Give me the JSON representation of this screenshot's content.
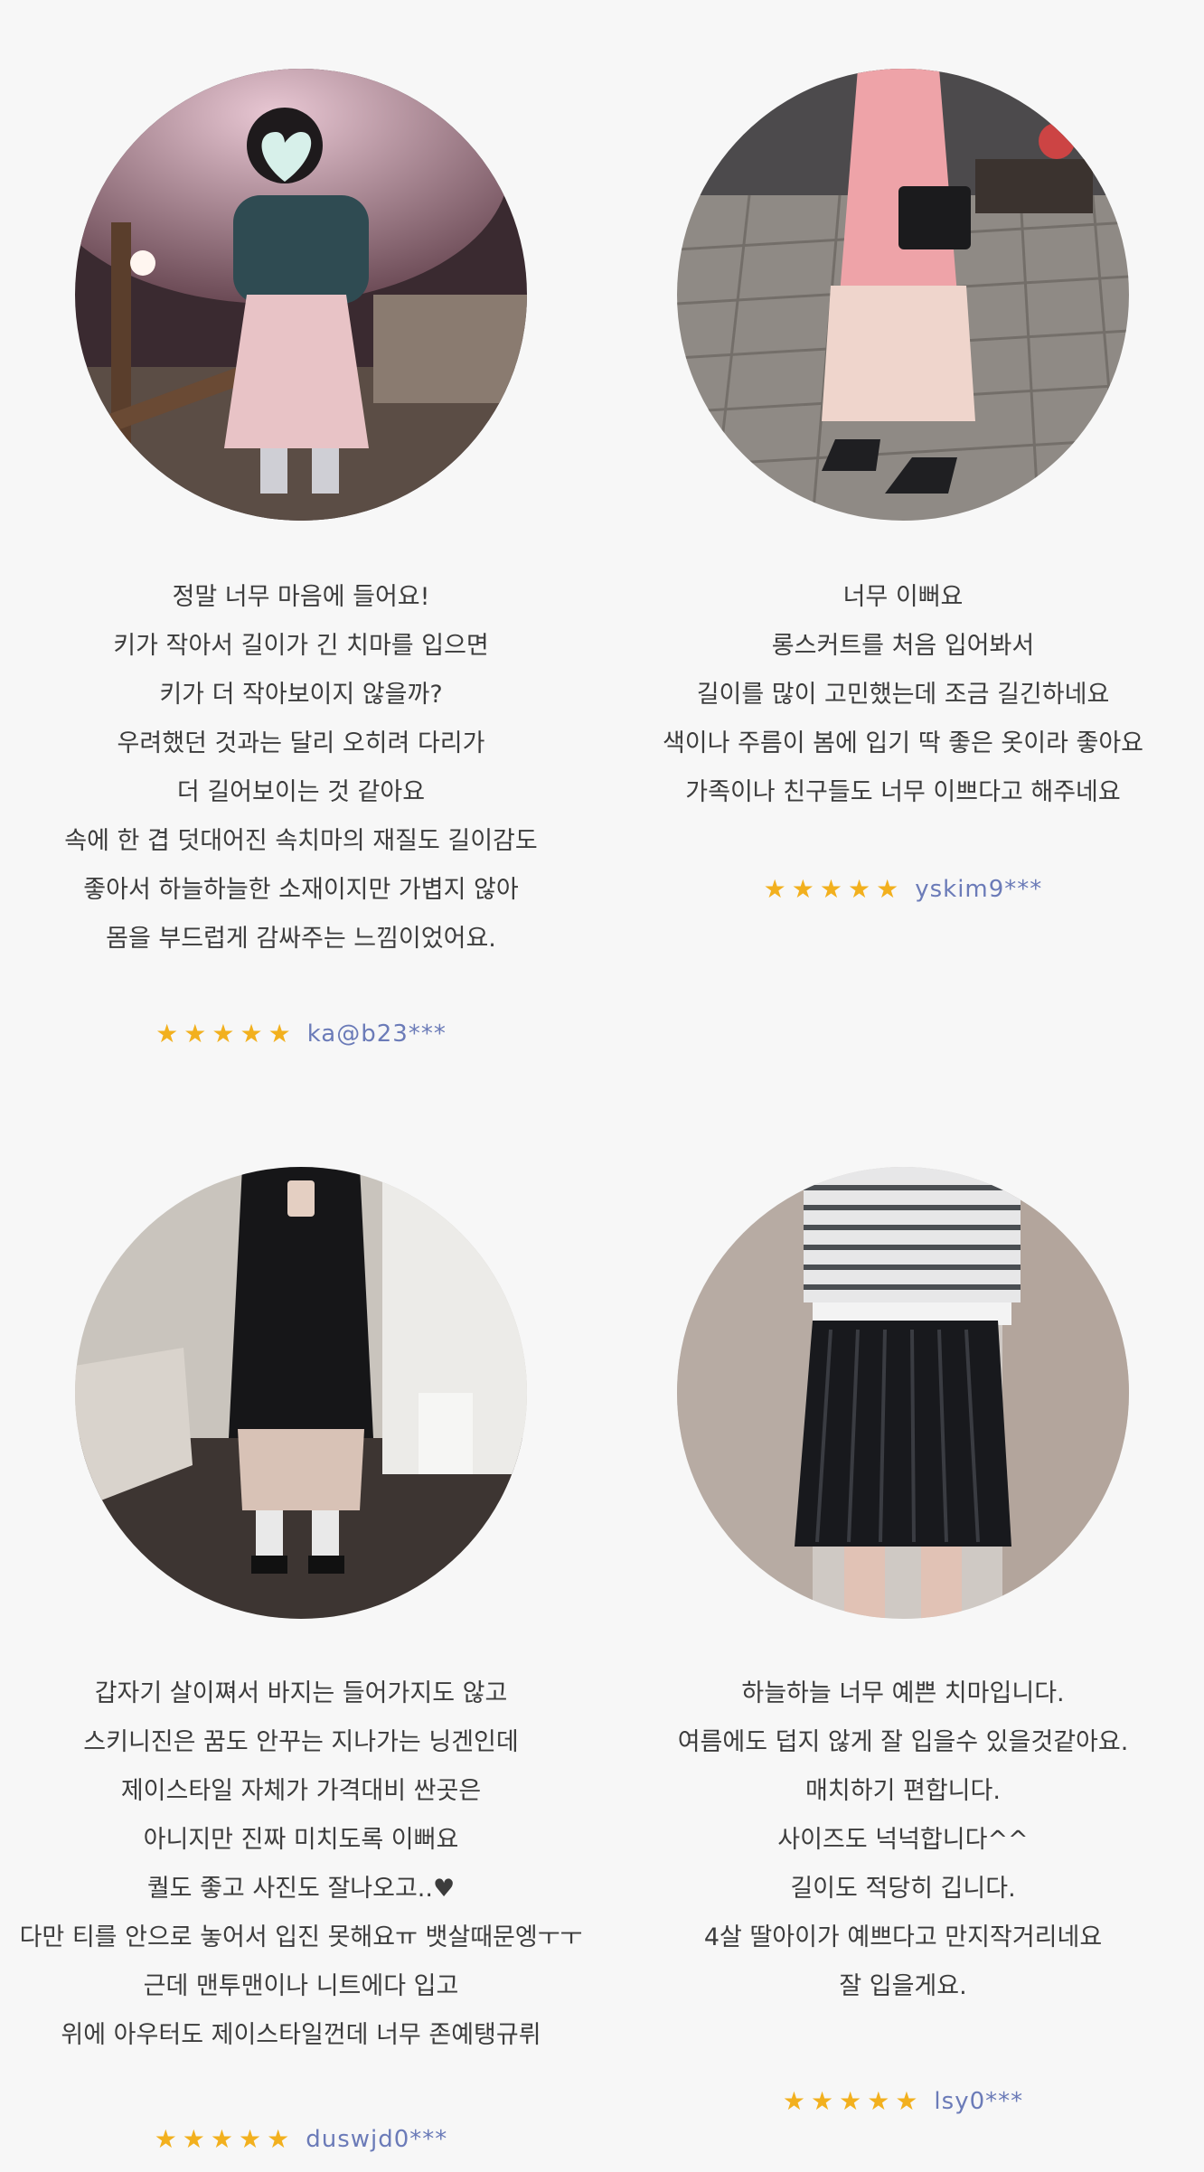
{
  "colors": {
    "background": "#f7f7f7",
    "star": "#f2b01e",
    "username": "#6b7bb8",
    "text": "#3c3c3c"
  },
  "reviews": [
    {
      "photo_icon": "review-photo",
      "lines": [
        "정말 너무 마음에 들어요!",
        "키가 작아서 길이가 긴 치마를 입으면",
        "키가 더 작아보이지 않을까?",
        "우려했던 것과는 달리 오히려 다리가",
        "더 길어보이는 것 같아요",
        "속에 한 겹 덧대어진 속치마의 재질도 길이감도",
        "좋아서 하늘하늘한 소재이지만 가볍지 않아",
        "몸을 부드럽게 감싸주는 느낌이었어요."
      ],
      "stars": [
        "★",
        "★",
        "★",
        "★",
        "★"
      ],
      "rating": 5,
      "user": "ka@b23***"
    },
    {
      "photo_icon": "review-photo",
      "lines": [
        "너무 이뻐요",
        "롱스커트를 처음 입어봐서",
        "길이를 많이 고민했는데 조금 길긴하네요",
        "색이나 주름이 봄에 입기 딱 좋은 옷이라 좋아요",
        "가족이나 친구들도 너무 이쁘다고 해주네요"
      ],
      "stars": [
        "★",
        "★",
        "★",
        "★",
        "★"
      ],
      "rating": 5,
      "user": "yskim9***"
    },
    {
      "photo_icon": "review-photo",
      "lines": [
        "갑자기 살이쪄서 바지는 들어가지도 않고",
        "스키니진은 꿈도 안꾸는 지나가는 닝겐인데",
        "제이스타일 자체가 가격대비 싼곳은",
        "아니지만 진짜 미치도록 이뻐요",
        "퀄도 좋고 사진도 잘나오고..♥",
        "다만 티를 안으로 놓어서 입진 못해요ㅠ 뱃살때문엥ㅜㅜ",
        "근데 맨투맨이나 니트에다 입고",
        "위에 아우터도 제이스타일껀데 너무 존예탱규뤼"
      ],
      "stars": [
        "★",
        "★",
        "★",
        "★",
        "★"
      ],
      "rating": 5,
      "user": "duswjd0***"
    },
    {
      "photo_icon": "review-photo",
      "lines": [
        "하늘하늘 너무 예쁜 치마입니다.",
        "여름에도 덥지 않게 잘 입을수 있을것같아요.",
        "매치하기 편합니다.",
        "사이즈도 넉넉합니다^^",
        "길이도 적당히 깁니다.",
        "4살 딸아이가 예쁘다고 만지작거리네요",
        "잘 입을게요."
      ],
      "stars": [
        "★",
        "★",
        "★",
        "★",
        "★"
      ],
      "rating": 5,
      "user": "lsy0***"
    }
  ]
}
